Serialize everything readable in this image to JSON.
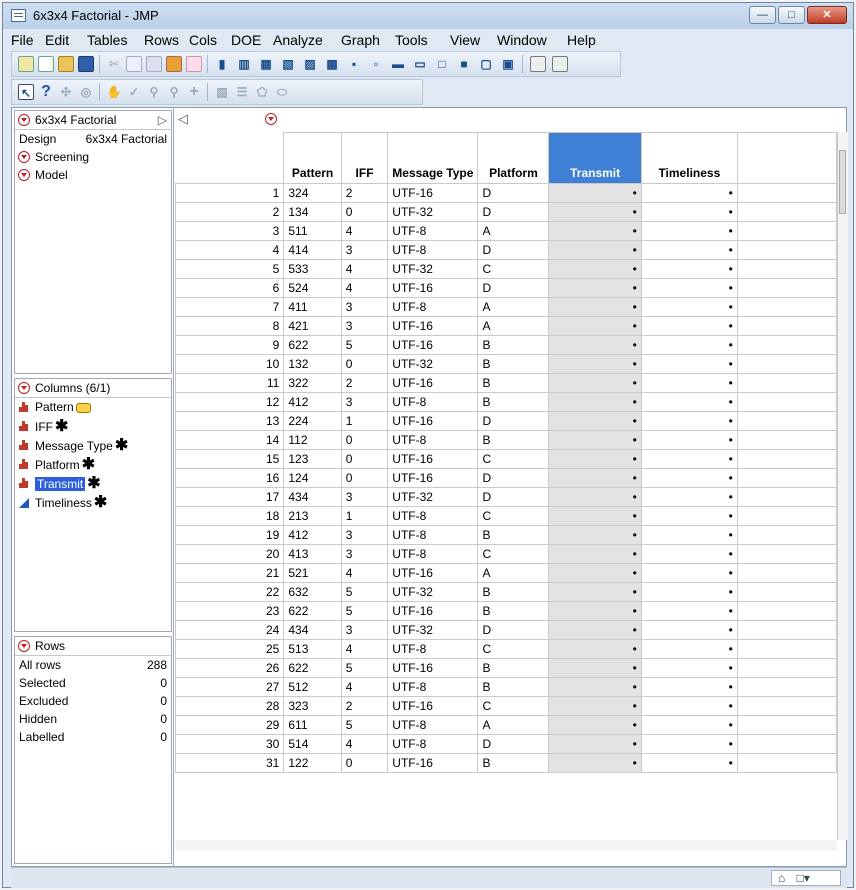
{
  "window": {
    "title": "6x3x4 Factorial - JMP"
  },
  "menu": [
    "File",
    "Edit",
    "Tables",
    "Rows",
    "Cols",
    "DOE",
    "Analyze",
    "Graph",
    "Tools",
    "View",
    "Window",
    "Help"
  ],
  "table_panel": {
    "title": "6x3x4 Factorial",
    "design_label": "Design",
    "design_value": "6x3x4 Factorial",
    "scripts": [
      "Screening",
      "Model"
    ]
  },
  "columns_panel": {
    "title": "Columns (6/1)",
    "columns": [
      {
        "name": "Pattern",
        "icon": "nominal-bar-icon",
        "marker": "key-icon"
      },
      {
        "name": "IFF",
        "icon": "nominal-bar-icon",
        "marker": "asterisk"
      },
      {
        "name": "Message Type",
        "icon": "nominal-bar-icon",
        "marker": "asterisk"
      },
      {
        "name": "Platform",
        "icon": "nominal-bar-icon",
        "marker": "asterisk"
      },
      {
        "name": "Transmit",
        "icon": "nominal-bar-icon",
        "marker": "asterisk",
        "selected": true
      },
      {
        "name": "Timeliness",
        "icon": "continuous-triangle-icon",
        "marker": "asterisk"
      }
    ]
  },
  "rows_panel": {
    "title": "Rows",
    "stats": [
      {
        "label": "All rows",
        "value": "288"
      },
      {
        "label": "Selected",
        "value": "0"
      },
      {
        "label": "Excluded",
        "value": "0"
      },
      {
        "label": "Hidden",
        "value": "0"
      },
      {
        "label": "Labelled",
        "value": "0"
      }
    ]
  },
  "grid": {
    "headers": [
      "Pattern",
      "IFF",
      "Message Type",
      "Platform",
      "Transmit",
      "Timeliness"
    ],
    "missing_symbol": "•",
    "rows": [
      [
        "1",
        "324",
        "2",
        "UTF-16",
        "D"
      ],
      [
        "2",
        "134",
        "0",
        "UTF-32",
        "D"
      ],
      [
        "3",
        "511",
        "4",
        "UTF-8",
        "A"
      ],
      [
        "4",
        "414",
        "3",
        "UTF-8",
        "D"
      ],
      [
        "5",
        "533",
        "4",
        "UTF-32",
        "C"
      ],
      [
        "6",
        "524",
        "4",
        "UTF-16",
        "D"
      ],
      [
        "7",
        "411",
        "3",
        "UTF-8",
        "A"
      ],
      [
        "8",
        "421",
        "3",
        "UTF-16",
        "A"
      ],
      [
        "9",
        "622",
        "5",
        "UTF-16",
        "B"
      ],
      [
        "10",
        "132",
        "0",
        "UTF-32",
        "B"
      ],
      [
        "11",
        "322",
        "2",
        "UTF-16",
        "B"
      ],
      [
        "12",
        "412",
        "3",
        "UTF-8",
        "B"
      ],
      [
        "13",
        "224",
        "1",
        "UTF-16",
        "D"
      ],
      [
        "14",
        "112",
        "0",
        "UTF-8",
        "B"
      ],
      [
        "15",
        "123",
        "0",
        "UTF-16",
        "C"
      ],
      [
        "16",
        "124",
        "0",
        "UTF-16",
        "D"
      ],
      [
        "17",
        "434",
        "3",
        "UTF-32",
        "D"
      ],
      [
        "18",
        "213",
        "1",
        "UTF-8",
        "C"
      ],
      [
        "19",
        "412",
        "3",
        "UTF-8",
        "B"
      ],
      [
        "20",
        "413",
        "3",
        "UTF-8",
        "C"
      ],
      [
        "21",
        "521",
        "4",
        "UTF-16",
        "A"
      ],
      [
        "22",
        "632",
        "5",
        "UTF-32",
        "B"
      ],
      [
        "23",
        "622",
        "5",
        "UTF-16",
        "B"
      ],
      [
        "24",
        "434",
        "3",
        "UTF-32",
        "D"
      ],
      [
        "25",
        "513",
        "4",
        "UTF-8",
        "C"
      ],
      [
        "26",
        "622",
        "5",
        "UTF-16",
        "B"
      ],
      [
        "27",
        "512",
        "4",
        "UTF-8",
        "B"
      ],
      [
        "28",
        "323",
        "2",
        "UTF-16",
        "C"
      ],
      [
        "29",
        "611",
        "5",
        "UTF-8",
        "A"
      ],
      [
        "30",
        "514",
        "4",
        "UTF-8",
        "D"
      ],
      [
        "31",
        "122",
        "0",
        "UTF-16",
        "B"
      ]
    ]
  }
}
